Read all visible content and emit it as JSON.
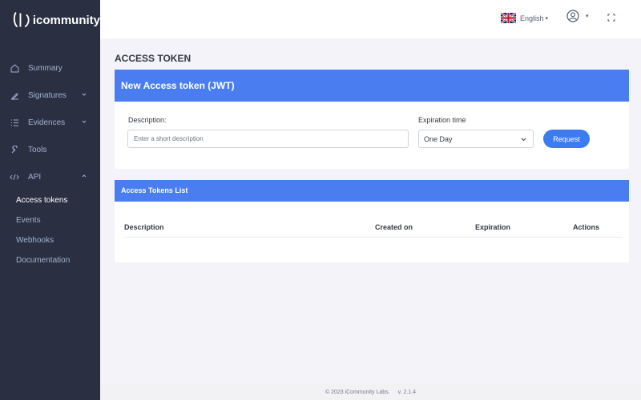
{
  "brand": {
    "name": "icommunity",
    "icon": "icommunity-logo-icon"
  },
  "sidebar": {
    "items": [
      {
        "label": "Summary",
        "icon": "home-icon"
      },
      {
        "label": "Signatures",
        "icon": "pen-icon",
        "expandable": true
      },
      {
        "label": "Evidences",
        "icon": "list-icon",
        "expandable": true
      },
      {
        "label": "Tools",
        "icon": "tools-icon"
      },
      {
        "label": "API",
        "icon": "code-icon",
        "expandable": true,
        "expanded": true
      }
    ],
    "subitems": [
      {
        "label": "Access tokens",
        "active": true
      },
      {
        "label": "Events"
      },
      {
        "label": "Webhooks"
      },
      {
        "label": "Documentation"
      }
    ]
  },
  "topbar": {
    "language": "English",
    "language_icon": "uk-flag-icon",
    "user_icon": "user-circle-icon",
    "fullscreen_icon": "fullscreen-icon"
  },
  "page": {
    "title": "ACCESS TOKEN"
  },
  "new_token": {
    "header": "New Access token (JWT)",
    "description_label": "Description:",
    "description_placeholder": "Enter a short description",
    "expiration_label": "Expiration time",
    "expiration_value": "One Day",
    "request_button": "Request"
  },
  "tokens_list": {
    "header": "Access Tokens List",
    "columns": [
      "Description",
      "Created on",
      "Expiration",
      "Actions"
    ]
  },
  "footer": {
    "copyright": "© 2023 iCommunity Labs.",
    "version": "v. 2.1.4"
  },
  "colors": {
    "primary": "#4a7ef0",
    "sidebar": "#2a3042",
    "background": "#f3f3f9"
  }
}
